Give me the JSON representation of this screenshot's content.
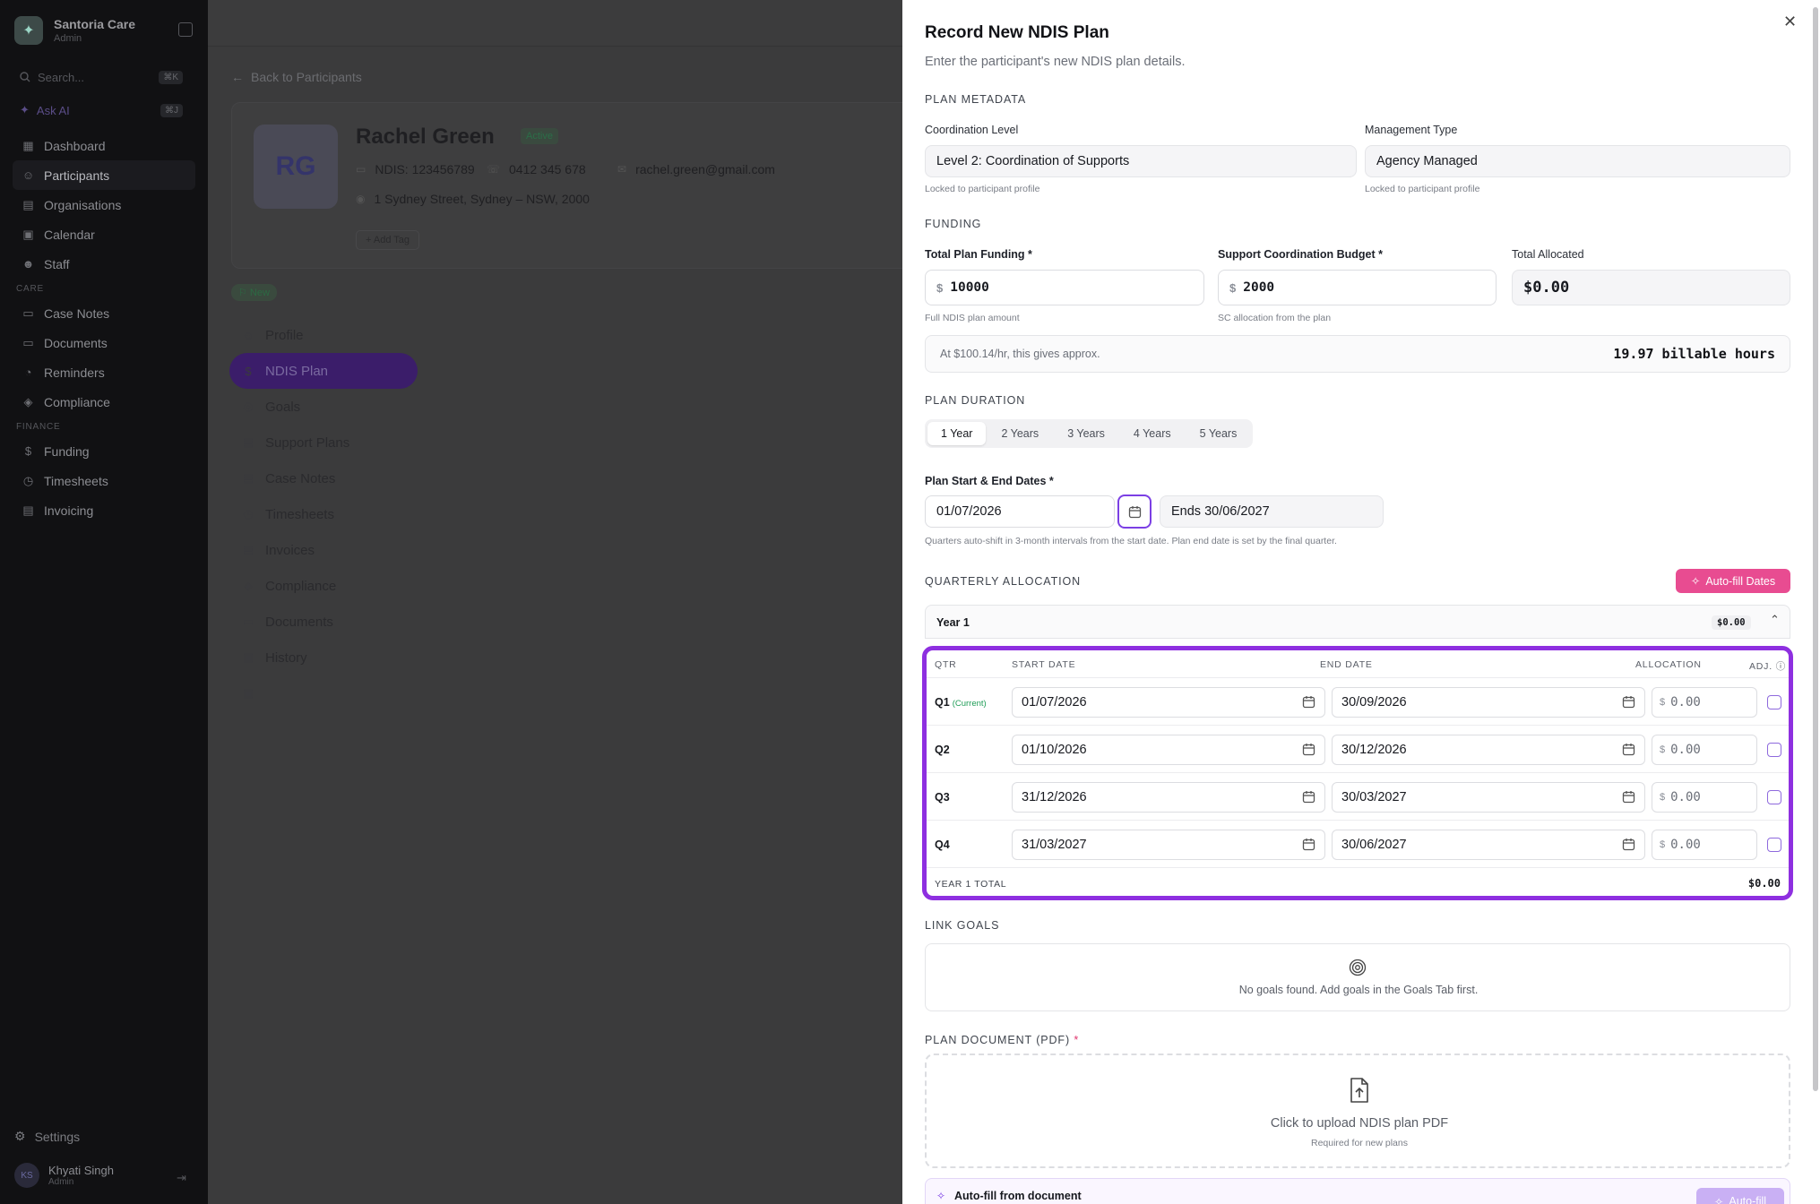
{
  "sidebar": {
    "brand_name": "Santoria Care",
    "brand_role": "Admin",
    "search_placeholder": "Search...",
    "search_kbd": "⌘K",
    "ask_ai": "Ask AI",
    "ask_ai_kbd": "⌘J",
    "nav": [
      {
        "label": "Dashboard",
        "icon": "grid-icon"
      },
      {
        "label": "Participants",
        "icon": "users-icon"
      },
      {
        "label": "Organisations",
        "icon": "building-icon"
      },
      {
        "label": "Calendar",
        "icon": "calendar-icon"
      },
      {
        "label": "Staff",
        "icon": "staff-icon"
      }
    ],
    "care_label": "CARE",
    "care": [
      {
        "label": "Case Notes",
        "icon": "folder-icon"
      },
      {
        "label": "Documents",
        "icon": "folder-icon"
      },
      {
        "label": "Reminders",
        "icon": "bell-icon"
      },
      {
        "label": "Compliance",
        "icon": "shield-icon"
      }
    ],
    "finance_label": "FINANCE",
    "finance": [
      {
        "label": "Funding",
        "icon": "dollar-icon"
      },
      {
        "label": "Timesheets",
        "icon": "clock-icon"
      },
      {
        "label": "Invoicing",
        "icon": "invoice-icon"
      }
    ],
    "settings": "Settings",
    "user_initials": "KS",
    "user_name": "Khyati Singh",
    "user_role": "Admin"
  },
  "main": {
    "back_link": "Back to Participants",
    "participant": {
      "initials": "RG",
      "name": "Rachel Green",
      "status": "Active",
      "ndis": "NDIS: 123456789",
      "phone": "0412 345 678",
      "email": "rachel.green@gmail.com",
      "address": "1 Sydney Street, Sydney – NSW, 2000",
      "add_tag": "Add Tag"
    },
    "badge_new": "New",
    "tabs": [
      {
        "label": "Profile",
        "icon": "user-icon"
      },
      {
        "label": "NDIS Plan",
        "icon": "dollar-icon"
      },
      {
        "label": "Goals",
        "icon": "target-icon"
      },
      {
        "label": "Support Plans",
        "icon": "clipboard-icon"
      },
      {
        "label": "Case Notes",
        "icon": "file-icon"
      },
      {
        "label": "Timesheets",
        "icon": "clock-icon"
      },
      {
        "label": "Invoices",
        "icon": "invoice-icon"
      },
      {
        "label": "Compliance",
        "icon": "shield-icon"
      },
      {
        "label": "Documents",
        "icon": "folder-icon"
      },
      {
        "label": "History",
        "icon": "history-icon"
      }
    ]
  },
  "drawer": {
    "title": "Record New NDIS Plan",
    "subtitle": "Enter the participant's new NDIS plan details.",
    "plan_metadata_label": "PLAN METADATA",
    "coordination_label": "Coordination Level",
    "coordination_value": "Level 2: Coordination of Supports",
    "coordination_help": "Locked to participant profile",
    "management_label": "Management Type",
    "management_value": "Agency Managed",
    "management_help": "Locked to participant profile",
    "funding_label": "FUNDING",
    "total_funding_label": "Total Plan Funding *",
    "total_funding_currency": "$",
    "total_funding_value": "10000",
    "total_funding_help": "Full NDIS plan amount",
    "sc_budget_label": "Support Coordination Budget *",
    "sc_budget_currency": "$",
    "sc_budget_value": "2000",
    "sc_budget_help": "SC allocation from the plan",
    "total_allocated_label": "Total Allocated",
    "total_allocated_value": "$0.00",
    "approx_text": "At $100.14/hr, this gives approx.",
    "approx_hours": "19.97 billable hours",
    "plan_duration_label": "PLAN DURATION",
    "durations": [
      "1 Year",
      "2 Years",
      "3 Years",
      "4 Years",
      "5 Years"
    ],
    "selected_duration": "1 Year",
    "dates_label": "Plan Start & End Dates *",
    "start_date": "01/07/2026",
    "end_date": "Ends 30/06/2027",
    "dates_help": "Quarters auto-shift in 3-month intervals from the start date. Plan end date is set by the final quarter.",
    "quarterly_label": "QUARTERLY ALLOCATION",
    "autofill_dates": "Auto-fill Dates",
    "year_title": "Year 1",
    "year_amount": "$0.00",
    "table_headers": {
      "qtr": "QTR",
      "start": "START DATE",
      "end": "END DATE",
      "allocation": "ALLOCATION",
      "adj": "ADJ."
    },
    "quarters": [
      {
        "qtr": "Q1",
        "tag": "(Current)",
        "start": "01/07/2026",
        "end": "30/09/2026",
        "currency": "$",
        "allocation": "0.00"
      },
      {
        "qtr": "Q2",
        "tag": "",
        "start": "01/10/2026",
        "end": "30/12/2026",
        "currency": "$",
        "allocation": "0.00"
      },
      {
        "qtr": "Q3",
        "tag": "",
        "start": "31/12/2026",
        "end": "30/03/2027",
        "currency": "$",
        "allocation": "0.00"
      },
      {
        "qtr": "Q4",
        "tag": "",
        "start": "31/03/2027",
        "end": "30/06/2027",
        "currency": "$",
        "allocation": "0.00"
      }
    ],
    "year_total_label": "YEAR 1 TOTAL",
    "year_total_value": "$0.00",
    "link_goals_label": "LINK GOALS",
    "no_goals_text": "No goals found. Add goals in the Goals Tab first.",
    "plan_document_label": "PLAN DOCUMENT (PDF)",
    "plan_document_req": "*",
    "upload_text": "Click to upload NDIS plan PDF",
    "upload_help": "Required for new plans",
    "autofill_doc_text": "Auto-fill from document",
    "autofill_doc_btn": "Auto-fill"
  },
  "colors": {
    "accent_purple": "#8e2fe0",
    "pink_button": "#e84c91",
    "current_green": "#1f9d57"
  }
}
